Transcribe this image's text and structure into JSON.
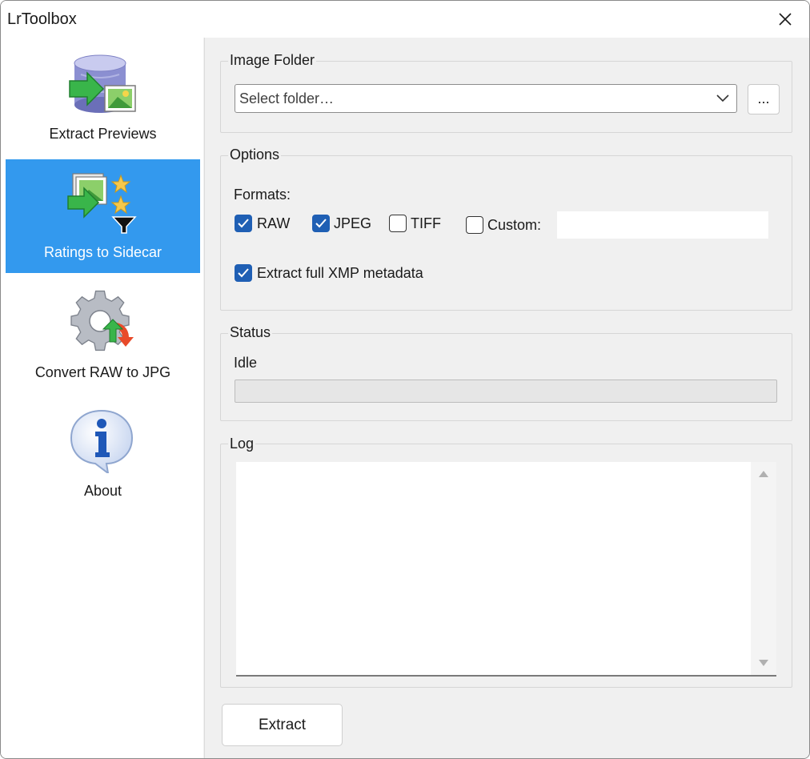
{
  "window": {
    "title": "LrToolbox"
  },
  "sidebar": {
    "items": [
      {
        "label": "Extract Previews",
        "icon": "database-export-icon",
        "selected": false
      },
      {
        "label": "Ratings to Sidecar",
        "icon": "ratings-filter-icon",
        "selected": true
      },
      {
        "label": "Convert RAW to JPG",
        "icon": "gear-convert-icon",
        "selected": false
      },
      {
        "label": "About",
        "icon": "info-bubble-icon",
        "selected": false
      }
    ]
  },
  "image_folder": {
    "title": "Image Folder",
    "placeholder": "Select folder…",
    "browse_label": "..."
  },
  "options": {
    "title": "Options",
    "formats_label": "Formats:",
    "formats": [
      {
        "label": "RAW",
        "checked": true
      },
      {
        "label": "JPEG",
        "checked": true
      },
      {
        "label": "TIFF",
        "checked": false
      },
      {
        "label": "Custom:",
        "checked": false
      }
    ],
    "custom_value": "",
    "xmp": {
      "label": "Extract full XMP metadata",
      "checked": true
    }
  },
  "status": {
    "title": "Status",
    "text": "Idle",
    "progress": 0
  },
  "log": {
    "title": "Log",
    "content": ""
  },
  "actions": {
    "extract_label": "Extract"
  },
  "colors": {
    "accent": "#3399ee",
    "checkbox": "#1f5fb4"
  }
}
